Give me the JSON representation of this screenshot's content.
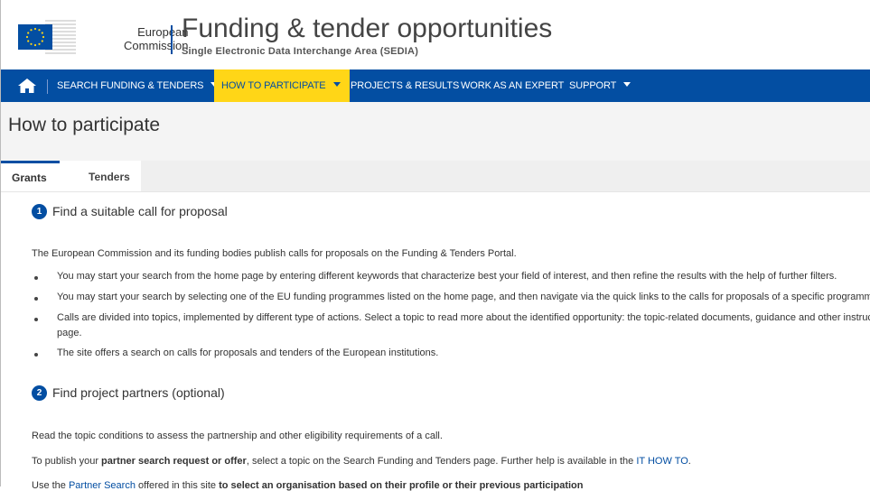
{
  "colors": {
    "brand": "#034ea2",
    "accent": "#ffd617"
  },
  "header": {
    "ec_line1": "European",
    "ec_line2": "Commission",
    "title": "Funding & tender opportunities",
    "subtitle": "Single Electronic Data Interchange Area (SEDIA)"
  },
  "nav": {
    "home_icon": "home-icon",
    "items": [
      {
        "label": "SEARCH FUNDING & TENDERS"
      },
      {
        "label": "HOW TO PARTICIPATE"
      },
      {
        "label": "PROJECTS & RESULTS"
      },
      {
        "label": "WORK AS AN EXPERT"
      },
      {
        "label": "SUPPORT"
      }
    ]
  },
  "page": {
    "title": "How to participate"
  },
  "tabs": [
    {
      "label": "Grants"
    },
    {
      "label": "Tenders"
    }
  ],
  "steps": [
    {
      "number": "1",
      "title": "Find a suitable call for proposal",
      "intro": "The European Commission and its funding bodies publish calls for proposals on the Funding & Tenders Portal.",
      "bullets": [
        "You may start your search from the home page by entering different keywords that characterize best your field of interest, and then refine the results with the help of further filters.",
        "You may start your search by selecting one of the EU funding programmes listed on the home page, and then navigate via the quick links to the calls for proposals of a specific programme.",
        "Calls are divided into topics, implemented by different type of actions. Select a topic to read more about the identified opportunity: the topic-related documents, guidance and other instructio",
        "page.",
        "The site offers a search on calls for proposals and tenders of the European institutions."
      ]
    },
    {
      "number": "2",
      "title": "Find project partners (optional)",
      "para1": "Read the topic conditions to assess the partnership and other eligibility requirements of a call.",
      "para2_a": "To publish your ",
      "para2_b": "partner search request or offer",
      "para2_c": ", select a topic on the Search Funding and Tenders page. Further help is available in the ",
      "para2_link": "IT HOW TO",
      "para2_d": ".",
      "para3_a": "Use the ",
      "para3_link": "Partner Search",
      "para3_b": " offered in this site ",
      "para3_c": "to select an organisation based on their profile or their previous participation"
    }
  ]
}
